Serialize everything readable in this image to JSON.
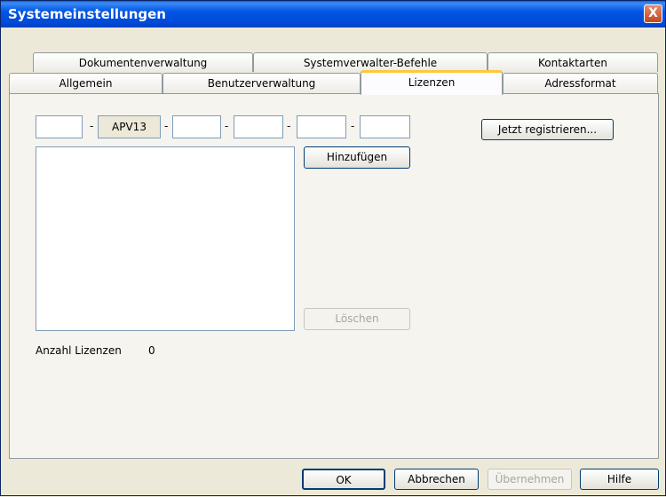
{
  "window": {
    "title": "Systemeinstellungen",
    "close_label": "X"
  },
  "tabs_row_top": [
    "Dokumentenverwaltung",
    "Systemverwalter-Befehle",
    "Kontaktarten"
  ],
  "tabs_row_bottom": [
    "Allgemein",
    "Benutzerverwaltung",
    "Lizenzen",
    "Adressformat"
  ],
  "active_tab": "Lizenzen",
  "license_key": {
    "fields": [
      "",
      "APV13",
      "",
      "",
      "",
      ""
    ],
    "separator": "-"
  },
  "buttons": {
    "register": "Jetzt registrieren...",
    "add": "Hinzufügen",
    "delete": "Löschen",
    "ok": "OK",
    "cancel": "Abbrechen",
    "apply": "Übernehmen",
    "help": "Hilfe"
  },
  "license_count": {
    "label": "Anzahl Lizenzen",
    "value": "0"
  }
}
